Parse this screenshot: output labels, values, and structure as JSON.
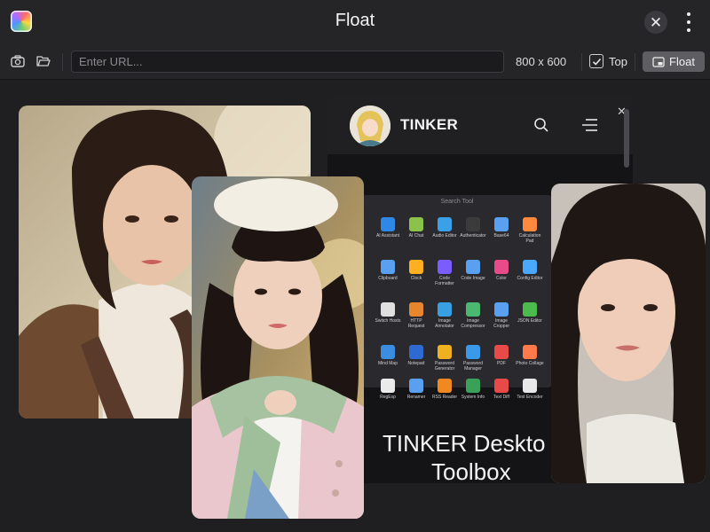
{
  "window": {
    "title": "Float"
  },
  "toolbar": {
    "url_placeholder": "Enter URL...",
    "size_text": "800 x 600",
    "top_label": "Top",
    "float_label": "Float"
  },
  "tinker": {
    "brand": "TINKER",
    "search_label": "Search Tool",
    "headline": [
      "TINKER Deskto",
      "Toolbox"
    ],
    "tools": [
      [
        {
          "label": "AI Assistant",
          "icon": "robot-icon",
          "color": "#2f88e6"
        },
        {
          "label": "AI Chat",
          "icon": "chat-icon",
          "color": "#8bc34a"
        },
        {
          "label": "Audio Editor",
          "icon": "audio-icon",
          "color": "#3aa0e8"
        },
        {
          "label": "Authenticator",
          "icon": "lock-icon",
          "color": "#3b3b3b"
        },
        {
          "label": "Base64",
          "icon": "base64-icon",
          "color": "#5aa0f0"
        },
        {
          "label": "Calculation Pad",
          "icon": "calculator-icon",
          "color": "#ff8a3d"
        }
      ],
      [
        {
          "label": "Clipboard",
          "icon": "clipboard-icon",
          "color": "#5aa0f0"
        },
        {
          "label": "Clock",
          "icon": "clock-icon",
          "color": "#ffb020"
        },
        {
          "label": "Code Formatter",
          "icon": "code-icon",
          "color": "#7a5cff"
        },
        {
          "label": "Code Image",
          "icon": "code-image-icon",
          "color": "#5aa0f0"
        },
        {
          "label": "Color",
          "icon": "color-icon",
          "color": "#e84a8a"
        },
        {
          "label": "Config Editor",
          "icon": "gear-icon",
          "color": "#4aa8ff"
        }
      ],
      [
        {
          "label": "Switch Hosts",
          "icon": "hosts-icon",
          "color": "#e0e0e0"
        },
        {
          "label": "HTTP Request",
          "icon": "http-icon",
          "color": "#e8862e"
        },
        {
          "label": "Image Annotator",
          "icon": "annotate-icon",
          "color": "#38a0e0"
        },
        {
          "label": "Image Compressor",
          "icon": "compress-icon",
          "color": "#4ab870"
        },
        {
          "label": "Image Cropper",
          "icon": "crop-icon",
          "color": "#5aa0f0"
        },
        {
          "label": "JSON Editor",
          "icon": "json-icon",
          "color": "#4cba4c"
        }
      ],
      [
        {
          "label": "Mind Map",
          "icon": "mindmap-icon",
          "color": "#3a8de0"
        },
        {
          "label": "Notepad",
          "icon": "notepad-icon",
          "color": "#2e6ad0"
        },
        {
          "label": "Password Generator",
          "icon": "key-icon",
          "color": "#f0b020"
        },
        {
          "label": "Password Manager",
          "icon": "password-icon",
          "color": "#3a9ae8"
        },
        {
          "label": "PDF",
          "icon": "pdf-icon",
          "color": "#e84a4a"
        },
        {
          "label": "Photo Collage",
          "icon": "collage-icon",
          "color": "#ff7a4a"
        }
      ],
      [
        {
          "label": "RegExp",
          "icon": "regexp-icon",
          "color": "#eaeaea"
        },
        {
          "label": "Renamer",
          "icon": "rename-icon",
          "color": "#5aa0f0"
        },
        {
          "label": "RSS Reader",
          "icon": "rss-icon",
          "color": "#f08a20"
        },
        {
          "label": "System Info",
          "icon": "info-icon",
          "color": "#3aa05a"
        },
        {
          "label": "Text Diff",
          "icon": "diff-icon",
          "color": "#e84a4a"
        },
        {
          "label": "Text Encoder",
          "icon": "encode-icon",
          "color": "#e8e8e8"
        }
      ]
    ]
  },
  "photos": [
    {
      "name": "photo-woman-brown-coat"
    },
    {
      "name": "photo-girl-beret-scarf"
    },
    {
      "name": "photo-woman-portrait-right"
    }
  ]
}
